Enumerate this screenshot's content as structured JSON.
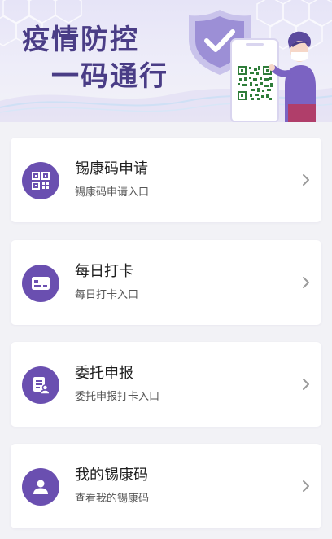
{
  "banner": {
    "line1": "疫情防控",
    "line2": "一码通行"
  },
  "menu": [
    {
      "title": "锡康码申请",
      "subtitle": "锡康码申请入口",
      "icon": "qr-code-icon"
    },
    {
      "title": "每日打卡",
      "subtitle": "每日打卡入口",
      "icon": "id-card-icon"
    },
    {
      "title": "委托申报",
      "subtitle": "委托申报打卡入口",
      "icon": "delegate-form-icon"
    },
    {
      "title": "我的锡康码",
      "subtitle": "查看我的锡康码",
      "icon": "user-icon"
    }
  ],
  "colors": {
    "accent": "#6a4fb0",
    "slogan": "#4a3d86",
    "background": "#f2f2f6",
    "card": "#ffffff"
  }
}
